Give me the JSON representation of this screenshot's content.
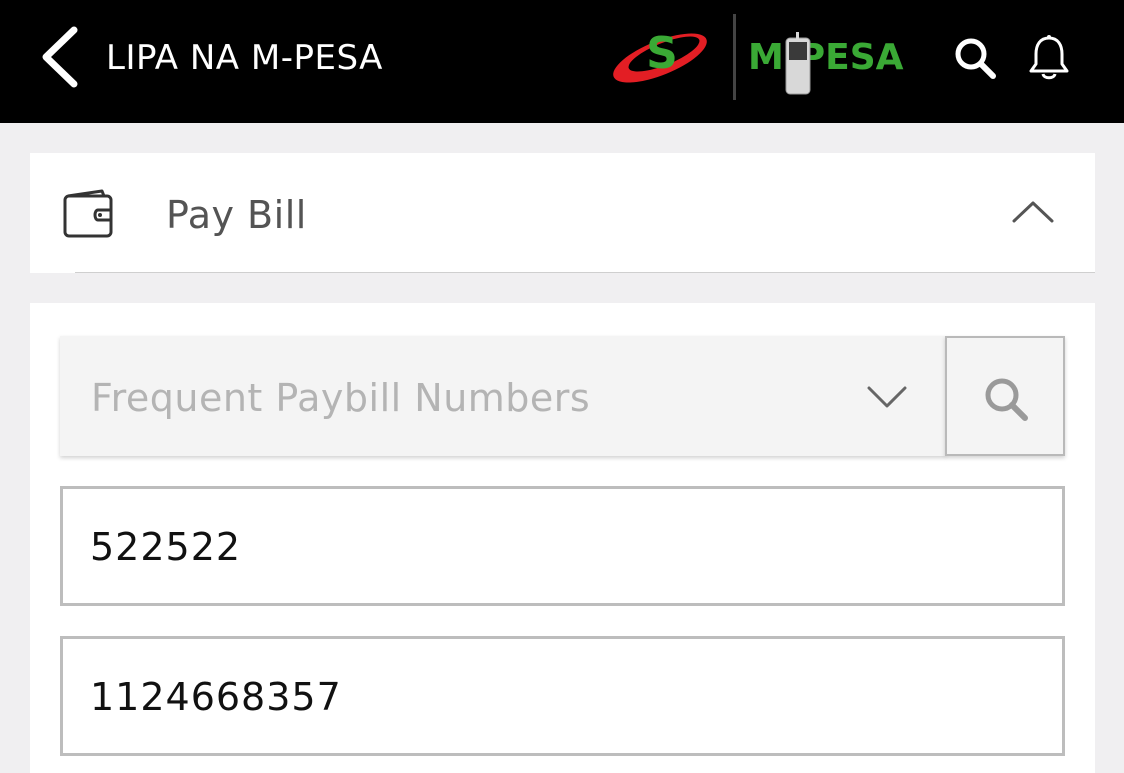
{
  "header": {
    "title": "LIPA NA M-PESA",
    "back_icon": "chevron-left-icon",
    "safaricom_logo": "S",
    "mpesa_logo": "M-PESA",
    "search_icon": "search-icon",
    "notification_icon": "bell-icon",
    "colors": {
      "background": "#000000",
      "safaricom_red": "#e31e24",
      "safaricom_green": "#3aa935",
      "mpesa_green": "#3aa935"
    }
  },
  "section": {
    "icon": "wallet-icon",
    "title": "Pay Bill",
    "toggle_icon": "chevron-up-icon"
  },
  "form": {
    "frequent_select": {
      "placeholder": "Frequent Paybill Numbers",
      "dropdown_icon": "chevron-down-icon",
      "search_icon": "search-icon"
    },
    "business_number": {
      "value": "522522"
    },
    "account_number": {
      "value": "1124668357"
    }
  }
}
